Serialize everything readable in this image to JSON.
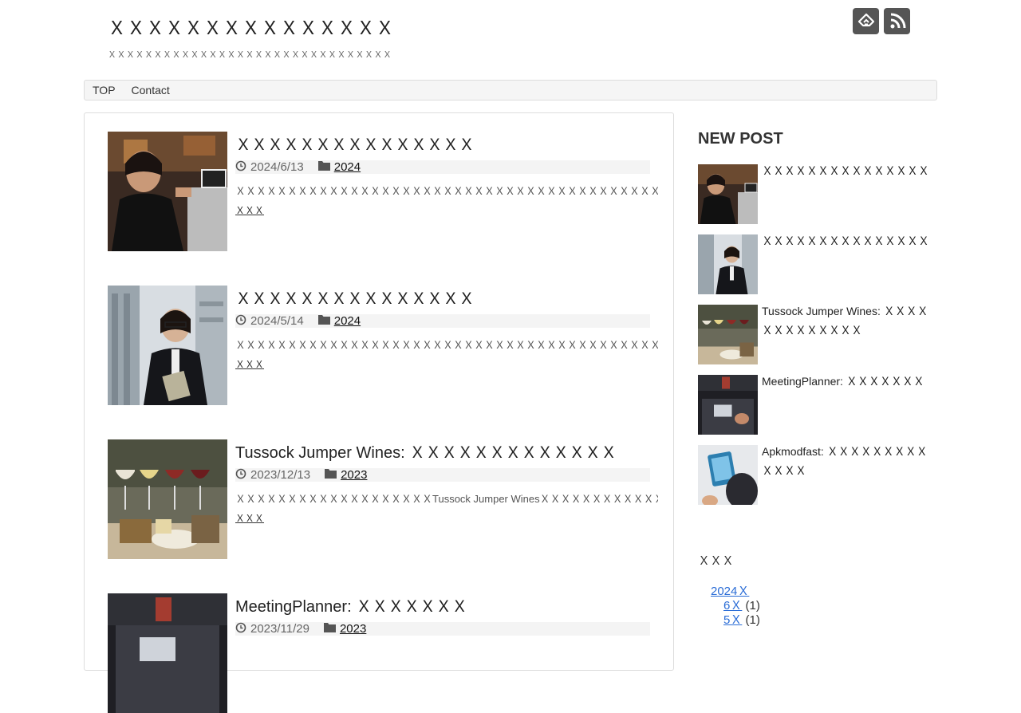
{
  "site": {
    "title": "ＸＸＸＸＸＸＸＸＸＸＸＸＸＸＸ",
    "description": "ＸＸＸＸＸＸＸＸＸＸＸＸＸＸＸＸＸＸＸＸＸＸＸＸＸＸＸＸＸＸＸ"
  },
  "header_icons": [
    "feedly-icon",
    "rss-icon"
  ],
  "nav": {
    "items": [
      "TOP",
      "Contact"
    ]
  },
  "posts": [
    {
      "title": "ＸＸＸＸＸＸＸＸＸＸＸＸＸＸＸ",
      "date": "2024/6/13",
      "category": "2024",
      "excerpt": "ＸＸＸＸＸＸＸＸＸＸＸＸＸＸＸＸＸＸＸＸＸＸＸＸＸＸＸＸＸＸＸＸＸＸＸＸＸＸＸＸＸＸＸＸＸＸＸＸＸＸ...",
      "more": "ＸＸＸ"
    },
    {
      "title": "ＸＸＸＸＸＸＸＸＸＸＸＸＸＸＸ",
      "date": "2024/5/14",
      "category": "2024",
      "excerpt": "ＸＸＸＸＸＸＸＸＸＸＸＸＸＸＸＸＸＸＸＸＸＸＸＸＸＸＸＸＸＸＸＸＸＸＸＸＸＸＸＸＸＸＸＸＸＸＸＸＸＸ...",
      "more": "ＸＸＸ"
    },
    {
      "title": "Tussock Jumper Wines: ＸＸＸＸＸＸＸＸＸＸＸＸＸ",
      "date": "2023/12/13",
      "category": "2023",
      "excerpt": "ＸＸＸＸＸＸＸＸＸＸＸＸＸＸＸＸＸＸＸTussock Jumper WinesＸＸＸＸＸＸＸＸＸＸＸＸＸＸＸＸＸＸＸＸ...",
      "more": "ＸＸＸ"
    },
    {
      "title": "MeetingPlanner: ＸＸＸＸＸＸＸ",
      "date": "2023/11/29",
      "category": "2023",
      "excerpt": "",
      "more": ""
    }
  ],
  "sidebar": {
    "new_post_heading": "NEW POST",
    "recent_posts": [
      "ＸＸＸＸＸＸＸＸＸＸＸＸＸＸＸ",
      "ＸＸＸＸＸＸＸＸＸＸＸＸＸＸＸ",
      "Tussock Jumper Wines: ＸＸＸＸＸＸＸＸＸＸＸＸＸ",
      "MeetingPlanner: ＸＸＸＸＸＸＸ",
      "Apkmodfast: ＸＸＸＸＸＸＸＸＸＸＸＸＸ"
    ],
    "archive_heading": "ＸＸＸ",
    "archive": {
      "year": "2024Ｘ",
      "months": [
        {
          "month": "6Ｘ",
          "count": "(1)"
        },
        {
          "month": "5Ｘ",
          "count": "(1)"
        }
      ]
    }
  },
  "colors": {
    "link": "#2a6cd6",
    "icon_bg": "#555555",
    "meta_bg": "#f4f4f4"
  }
}
